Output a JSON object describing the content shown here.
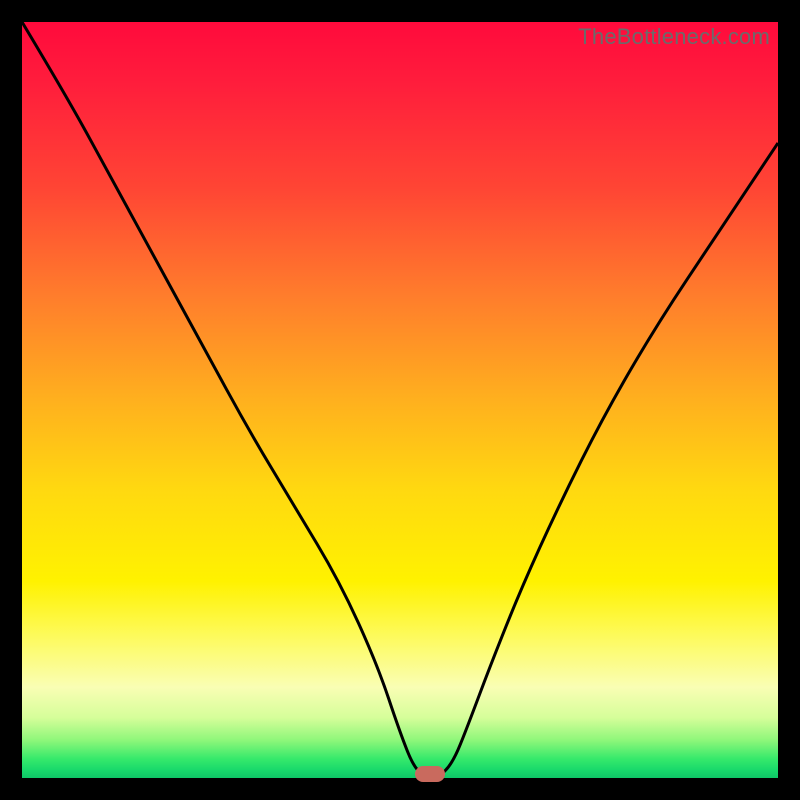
{
  "watermark": "TheBottleneck.com",
  "colors": {
    "curve": "#000000",
    "marker": "#c96a5e"
  },
  "chart_data": {
    "type": "line",
    "title": "",
    "xlabel": "",
    "ylabel": "",
    "xlim": [
      0,
      100
    ],
    "ylim": [
      0,
      100
    ],
    "grid": false,
    "series": [
      {
        "name": "bottleneck-curve",
        "x": [
          0,
          6,
          12,
          18,
          24,
          30,
          36,
          42,
          47,
          50,
          52,
          54,
          55,
          57,
          59,
          62,
          66,
          71,
          77,
          84,
          92,
          100
        ],
        "values": [
          100,
          90,
          79,
          68,
          57,
          46,
          36,
          26,
          15,
          6,
          1,
          0,
          0,
          2,
          7,
          15,
          25,
          36,
          48,
          60,
          72,
          84
        ]
      }
    ],
    "annotations": [
      {
        "name": "minimum-marker",
        "x": 54,
        "y": 0.5
      }
    ]
  }
}
